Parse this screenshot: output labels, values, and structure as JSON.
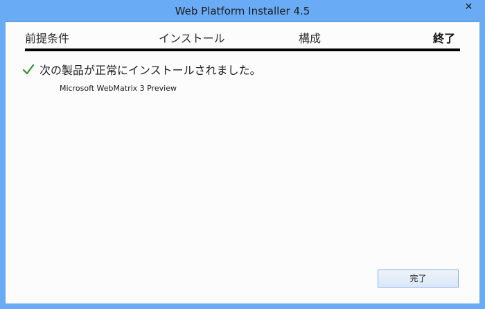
{
  "window": {
    "title": "Web Platform Installer 4.5",
    "close_glyph": "✕"
  },
  "steps": [
    {
      "label": "前提条件"
    },
    {
      "label": "インストール"
    },
    {
      "label": "構成"
    },
    {
      "label": "終了"
    }
  ],
  "status": {
    "icon": "check-icon",
    "message": "次の製品が正常にインストールされました。",
    "product": "Microsoft WebMatrix 3 Preview",
    "icon_color": "#2f8f2f"
  },
  "footer": {
    "finish_label": "完了"
  },
  "colors": {
    "frame": "#6aabf6",
    "client": "#fcfcfc",
    "accent": "#000000"
  }
}
